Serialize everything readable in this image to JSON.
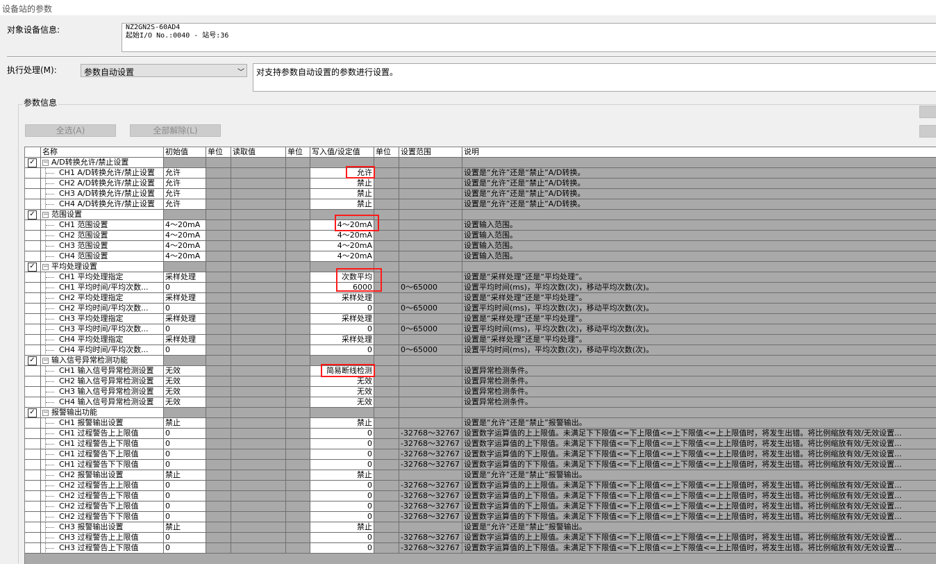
{
  "window": {
    "title": "设备站的参数"
  },
  "target_device": {
    "label": "对象设备信息:",
    "line1": "NZ2GN2S-60AD4",
    "line2": "起始I/O No.:0040 - 站号:36"
  },
  "execute": {
    "label": "执行处理(M):",
    "selected": "参数自动设置",
    "description": "对支持参数自动设置的参数进行设置。"
  },
  "param_info": {
    "label": "参数信息",
    "select_all": "全选(A)",
    "clear_all": "全部解除(L)"
  },
  "grid": {
    "headers": [
      "名称",
      "初始值",
      "单位",
      "读取值",
      "单位",
      "写入值/设定值",
      "单位",
      "设置范围",
      "说明"
    ],
    "rows": [
      {
        "type": "group",
        "name": "A/D转换允许/禁止设置"
      },
      {
        "type": "item",
        "name": "CH1 A/D转换允许/禁止设置",
        "init": "允许",
        "write": "允许",
        "range": "",
        "desc": "设置是“允许”还是“禁止”A/D转换。"
      },
      {
        "type": "item",
        "name": "CH2 A/D转换允许/禁止设置",
        "init": "允许",
        "write": "禁止",
        "range": "",
        "desc": "设置是“允许”还是“禁止”A/D转换。"
      },
      {
        "type": "item",
        "name": "CH3 A/D转换允许/禁止设置",
        "init": "允许",
        "write": "禁止",
        "range": "",
        "desc": "设置是“允许”还是“禁止”A/D转换。"
      },
      {
        "type": "item",
        "name": "CH4 A/D转换允许/禁止设置",
        "init": "允许",
        "write": "禁止",
        "range": "",
        "desc": "设置是“允许”还是“禁止”A/D转换。"
      },
      {
        "type": "group",
        "name": "范围设置"
      },
      {
        "type": "item",
        "name": "CH1 范围设置",
        "init": "4～20mA",
        "write": "4～20mA",
        "range": "",
        "desc": "设置输入范围。"
      },
      {
        "type": "item",
        "name": "CH2 范围设置",
        "init": "4～20mA",
        "write": "4～20mA",
        "range": "",
        "desc": "设置输入范围。"
      },
      {
        "type": "item",
        "name": "CH3 范围设置",
        "init": "4～20mA",
        "write": "4～20mA",
        "range": "",
        "desc": "设置输入范围。"
      },
      {
        "type": "item",
        "name": "CH4 范围设置",
        "init": "4～20mA",
        "write": "4～20mA",
        "range": "",
        "desc": "设置输入范围。"
      },
      {
        "type": "group",
        "name": "平均处理设置"
      },
      {
        "type": "item",
        "name": "CH1 平均处理指定",
        "init": "采样处理",
        "write": "次数平均",
        "range": "",
        "desc": "设置是“采样处理”还是“平均处理”。"
      },
      {
        "type": "item",
        "name": "CH1 平均时间/平均次数...",
        "init": "0",
        "write": "6000",
        "range": "0～65000",
        "desc": "设置平均时间(ms)，平均次数(次)，移动平均次数(次)。"
      },
      {
        "type": "item",
        "name": "CH2 平均处理指定",
        "init": "采样处理",
        "write": "采样处理",
        "range": "",
        "desc": "设置是“采样处理”还是“平均处理”。"
      },
      {
        "type": "item",
        "name": "CH2 平均时间/平均次数...",
        "init": "0",
        "write": "0",
        "range": "0～65000",
        "desc": "设置平均时间(ms)，平均次数(次)，移动平均次数(次)。"
      },
      {
        "type": "item",
        "name": "CH3 平均处理指定",
        "init": "采样处理",
        "write": "采样处理",
        "range": "",
        "desc": "设置是“采样处理”还是“平均处理”。"
      },
      {
        "type": "item",
        "name": "CH3 平均时间/平均次数...",
        "init": "0",
        "write": "0",
        "range": "0～65000",
        "desc": "设置平均时间(ms)，平均次数(次)，移动平均次数(次)。"
      },
      {
        "type": "item",
        "name": "CH4 平均处理指定",
        "init": "采样处理",
        "write": "采样处理",
        "range": "",
        "desc": "设置是“采样处理”还是“平均处理”。"
      },
      {
        "type": "item",
        "name": "CH4 平均时间/平均次数...",
        "init": "0",
        "write": "0",
        "range": "0～65000",
        "desc": "设置平均时间(ms)，平均次数(次)，移动平均次数(次)。"
      },
      {
        "type": "group",
        "name": "输入信号异常检测功能"
      },
      {
        "type": "item",
        "name": "CH1 输入信号异常检测设置",
        "init": "无效",
        "write": "简易断线检测",
        "range": "",
        "desc": "设置异常检测条件。"
      },
      {
        "type": "item",
        "name": "CH2 输入信号异常检测设置",
        "init": "无效",
        "write": "无效",
        "range": "",
        "desc": "设置异常检测条件。"
      },
      {
        "type": "item",
        "name": "CH3 输入信号异常检测设置",
        "init": "无效",
        "write": "无效",
        "range": "",
        "desc": "设置异常检测条件。"
      },
      {
        "type": "item",
        "name": "CH4 输入信号异常检测设置",
        "init": "无效",
        "write": "无效",
        "range": "",
        "desc": "设置异常检测条件。"
      },
      {
        "type": "group",
        "name": "报警输出功能"
      },
      {
        "type": "item",
        "name": "CH1 报警输出设置",
        "init": "禁止",
        "write": "禁止",
        "range": "",
        "desc": "设置是“允许”还是“禁止”报警输出。"
      },
      {
        "type": "item",
        "name": "CH1 过程警告上上限值",
        "init": "0",
        "write": "0",
        "range": "-32768～32767",
        "desc": "设置数字运算值的上上限值。未满足下下限值<=下上限值<=上下限值<=上上限值时，将发生出错。将比例缩放有效/无效设置..."
      },
      {
        "type": "item",
        "name": "CH1 过程警告上下限值",
        "init": "0",
        "write": "0",
        "range": "-32768～32767",
        "desc": "设置数字运算值的上下限值。未满足下下限值<=下上限值<=上下限值<=上上限值时，将发生出错。将比例缩放有效/无效设置..."
      },
      {
        "type": "item",
        "name": "CH1 过程警告下上限值",
        "init": "0",
        "write": "0",
        "range": "-32768～32767",
        "desc": "设置数字运算值的下上限值。未满足下下限值<=下上限值<=上下限值<=上上限值时，将发生出错。将比例缩放有效/无效设置..."
      },
      {
        "type": "item",
        "name": "CH1 过程警告下下限值",
        "init": "0",
        "write": "0",
        "range": "-32768～32767",
        "desc": "设置数字运算值的下下限值。未满足下下限值<=下上限值<=上下限值<=上上限值时，将发生出错。将比例缩放有效/无效设置..."
      },
      {
        "type": "item",
        "name": "CH2 报警输出设置",
        "init": "禁止",
        "write": "禁止",
        "range": "",
        "desc": "设置是“允许”还是“禁止”报警输出。"
      },
      {
        "type": "item",
        "name": "CH2 过程警告上上限值",
        "init": "0",
        "write": "0",
        "range": "-32768～32767",
        "desc": "设置数字运算值的上上限值。未满足下下限值<=下上限值<=上下限值<=上上限值时，将发生出错。将比例缩放有效/无效设置..."
      },
      {
        "type": "item",
        "name": "CH2 过程警告上下限值",
        "init": "0",
        "write": "0",
        "range": "-32768～32767",
        "desc": "设置数字运算值的上下限值。未满足下下限值<=下上限值<=上下限值<=上上限值时，将发生出错。将比例缩放有效/无效设置..."
      },
      {
        "type": "item",
        "name": "CH2 过程警告下上限值",
        "init": "0",
        "write": "0",
        "range": "-32768～32767",
        "desc": "设置数字运算值的下上限值。未满足下下限值<=下上限值<=上下限值<=上上限值时，将发生出错。将比例缩放有效/无效设置..."
      },
      {
        "type": "item",
        "name": "CH2 过程警告下下限值",
        "init": "0",
        "write": "0",
        "range": "-32768～32767",
        "desc": "设置数字运算值的下下限值。未满足下下限值<=下上限值<=上下限值<=上上限值时，将发生出错。将比例缩放有效/无效设置..."
      },
      {
        "type": "item",
        "name": "CH3 报警输出设置",
        "init": "禁止",
        "write": "禁止",
        "range": "",
        "desc": "设置是“允许”还是“禁止”报警输出。"
      },
      {
        "type": "item",
        "name": "CH3 过程警告上上限值",
        "init": "0",
        "write": "0",
        "range": "-32768～32767",
        "desc": "设置数字运算值的上上限值。未满足下下限值<=下上限值<=上下限值<=上上限值时，将发生出错。将比例缩放有效/无效设置..."
      },
      {
        "type": "item",
        "name": "CH3 过程警告上下限值",
        "init": "0",
        "write": "0",
        "range": "-32768～32767",
        "desc": "设置数字运算值的上下限值。未满足下下限值<=下上限值<=上下限值<=上上限值时，将发生出错。将比例缩放有效/无效设置..."
      }
    ]
  }
}
